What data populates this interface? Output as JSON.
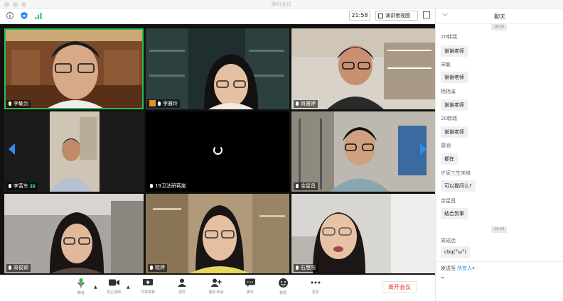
{
  "window": {
    "title": "腾讯会议"
  },
  "toolbar": {
    "clock": "21:58",
    "speaker_view_label": "演讲者视图"
  },
  "tiles": [
    {
      "name": "李敏剑",
      "active": true
    },
    {
      "name": "李雅玲",
      "host": true
    },
    {
      "name": "肖雅婷"
    },
    {
      "name": "李富车"
    },
    {
      "name": "19卫法研蒋崖"
    },
    {
      "name": "余星昌"
    },
    {
      "name": "周俊颖"
    },
    {
      "name": "晓婷"
    },
    {
      "name": "石慧阳"
    }
  ],
  "bottom": {
    "tools": [
      {
        "icon": "microphone-icon",
        "label": "静音"
      },
      {
        "icon": "video-camera-icon",
        "label": "停止视频"
      },
      {
        "icon": "share-screen-icon",
        "label": "共享屏幕"
      },
      {
        "icon": "members-icon",
        "label": "成员"
      },
      {
        "icon": "invite-icon",
        "label": "邀请·参会"
      },
      {
        "icon": "chat-icon",
        "label": "聊天"
      },
      {
        "icon": "emoji-icon",
        "label": "表情"
      },
      {
        "icon": "more-icon",
        "label": "更多"
      }
    ],
    "leave_label": "离开会议"
  },
  "chat": {
    "title": "聊天",
    "timestamps": [
      "18:50",
      "19:49"
    ],
    "messages": [
      {
        "sender": "20韩瑞",
        "text": "谢谢老师"
      },
      {
        "sender": "宋敏",
        "text": "谢谢老师"
      },
      {
        "sender": "杨扬溪",
        "text": "谢谢老师"
      },
      {
        "sender": "20韩瑞",
        "text": "谢谢老师"
      },
      {
        "sender": "雷涵",
        "text": "都在"
      },
      {
        "sender": "许家三生宋维",
        "text": "可以提问么?"
      },
      {
        "sender": "余星昌",
        "text": "结合到事"
      },
      {
        "sender": "周成远",
        "text": "cbq(°ω°)"
      }
    ],
    "send_to_label": "发送至",
    "send_to_value": "所有人▾"
  },
  "colors": {
    "accent": "#2d8cf0",
    "active_border": "#2bbd52",
    "leave": "#e33a3a"
  }
}
